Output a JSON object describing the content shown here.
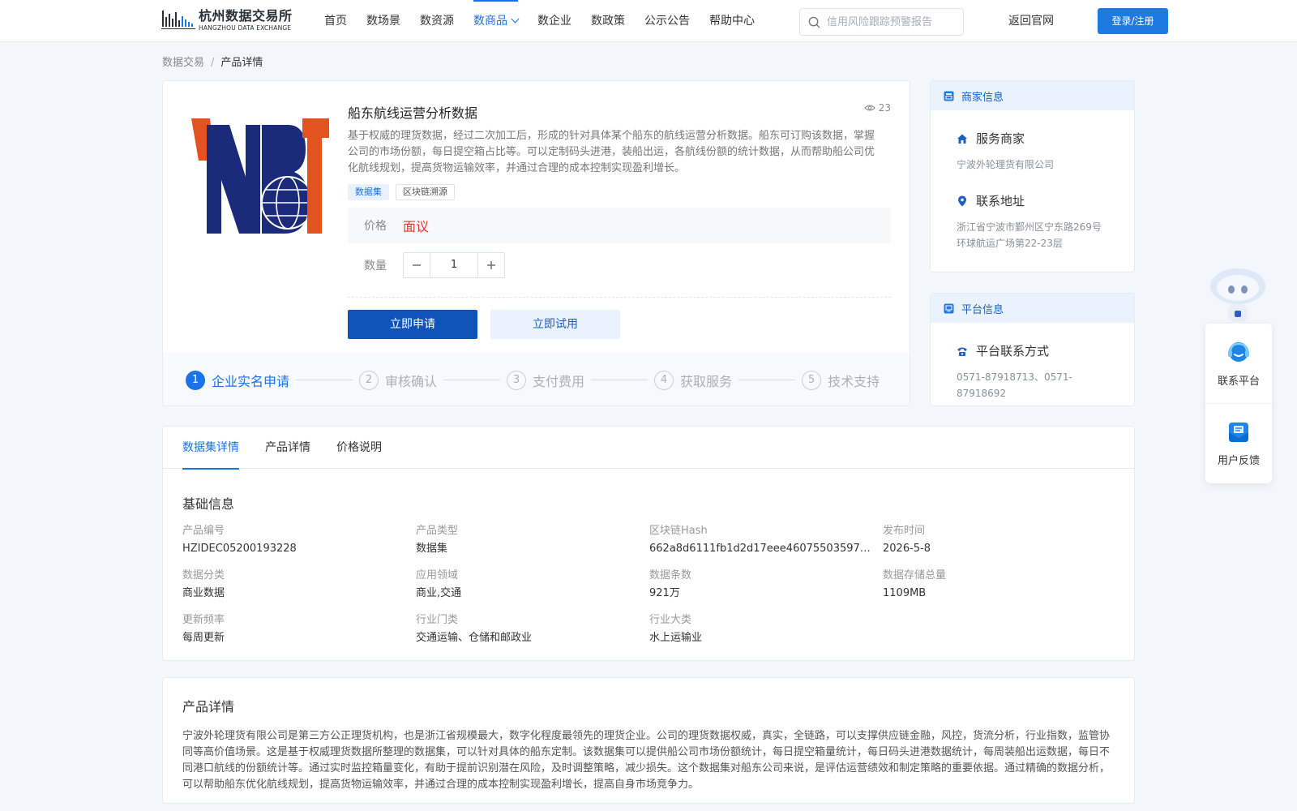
{
  "header": {
    "logo_cn": "杭州数据交易所",
    "logo_en": "HANGZHOU DATA EXCHANGE",
    "nav": [
      {
        "label": "首页"
      },
      {
        "label": "数场景"
      },
      {
        "label": "数资源"
      },
      {
        "label": "数商品",
        "active": true
      },
      {
        "label": "数企业"
      },
      {
        "label": "数政策"
      },
      {
        "label": "公示公告"
      },
      {
        "label": "帮助中心"
      }
    ],
    "search_placeholder": "信用风险跟踪预警报告",
    "back_label": "返回官网",
    "login_label": "登录/注册"
  },
  "breadcrumb": {
    "root": "数据交易",
    "sep": "/",
    "current": "产品详情"
  },
  "product": {
    "logo_text": "NBT",
    "title": "船东航线运营分析数据",
    "views": "23",
    "description": "基于权威的理货数据，经过二次加工后，形成的针对具体某个船东的航线运营分析数据。船东可订购该数据，掌握公司的市场份额，每日提空箱占比等。可以定制码头进港，装船出运，各航线份额的统计数据，从而帮助船公司优化航线规划，提高货物运输效率，并通过合理的成本控制实现盈利增长。",
    "tags": [
      "数据集",
      "区块链溯源"
    ],
    "price_label": "价格",
    "price_value": "面议",
    "qty_label": "数量",
    "qty_value": "1",
    "apply_label": "立即申请",
    "trial_label": "立即试用",
    "steps": [
      {
        "num": "1",
        "label": "企业实名申请"
      },
      {
        "num": "2",
        "label": "审核确认"
      },
      {
        "num": "3",
        "label": "支付费用"
      },
      {
        "num": "4",
        "label": "获取服务"
      },
      {
        "num": "5",
        "label": "技术支持"
      }
    ]
  },
  "merchant": {
    "head": "商家信息",
    "service_label": "服务商家",
    "service_value": "宁波外轮理货有限公司",
    "address_label": "联系地址",
    "address_value": "浙江省宁波市鄞州区宁东路269号环球航运广场第22-23层"
  },
  "platform": {
    "head": "平台信息",
    "contact_label": "平台联系方式",
    "contact_value": "0571-87918713、0571-87918692"
  },
  "floating": {
    "contact_label": "联系平台",
    "feedback_label": "用户反馈"
  },
  "details": {
    "tabs": [
      {
        "label": "数据集详情",
        "active": true
      },
      {
        "label": "产品详情"
      },
      {
        "label": "价格说明"
      }
    ],
    "section_title": "基础信息",
    "fields": [
      {
        "key": "产品编号",
        "value": "HZIDEC05200193228"
      },
      {
        "key": "产品类型",
        "value": "数据集"
      },
      {
        "key": "区块链Hash",
        "value": "662a8d6111fb1d2d17eee460755035973e…"
      },
      {
        "key": "发布时间",
        "value": "2026-5-8"
      },
      {
        "key": "数据分类",
        "value": "商业数据"
      },
      {
        "key": "应用领域",
        "value": "商业,交通"
      },
      {
        "key": "数据条数",
        "value": "921万"
      },
      {
        "key": "数据存储总量",
        "value": "1109MB"
      },
      {
        "key": "更新频率",
        "value": "每周更新"
      },
      {
        "key": "行业门类",
        "value": "交通运输、仓储和邮政业"
      },
      {
        "key": "行业大类",
        "value": "水上运输业"
      }
    ]
  },
  "product_detail": {
    "title": "产品详情",
    "text": "宁波外轮理货有限公司是第三方公正理货机构，也是浙江省规模最大，数字化程度最领先的理货企业。公司的理货数据权威，真实，全链路，可以支撑供应链金融，风控，货流分析，行业指数，监管协同等高价值场景。这是基于权威理货数据所整理的数据集，可以针对具体的船东定制。该数据集可以提供船公司市场份额统计，每日提空箱量统计，每日码头进港数据统计，每周装船出运数据，每日不同港口航线的份额统计等。通过实时监控箱量变化，有助于提前识别潜在风险，及时调整策略，减少损失。这个数据集对船东公司来说，是评估运营绩效和制定策略的重要依据。通过精确的数据分析，可以帮助船东优化航线规划，提高货物运输效率，并通过合理的成本控制实现盈利增长，提高自身市场竞争力。"
  }
}
